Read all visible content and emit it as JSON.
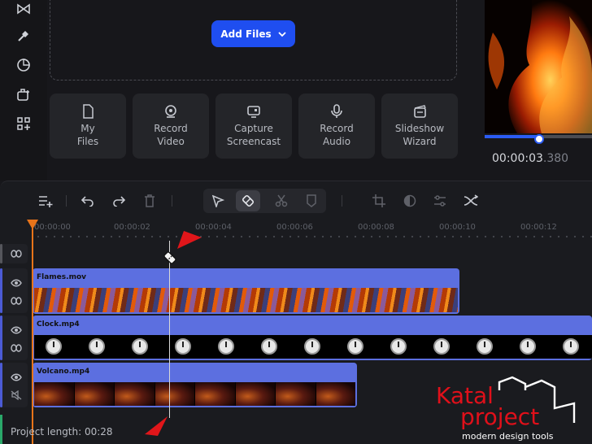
{
  "sidebar": {
    "icons": [
      "transitions-icon",
      "effects-icon",
      "filters-icon",
      "elements-icon",
      "more-icon"
    ]
  },
  "import_area": {
    "add_files_label": "Add Files"
  },
  "record_tiles": [
    {
      "label": "My\nFiles",
      "icon": "file-icon"
    },
    {
      "label": "Record\nVideo",
      "icon": "webcam-icon"
    },
    {
      "label": "Capture\nScreencast",
      "icon": "monitor-icon"
    },
    {
      "label": "Record\nAudio",
      "icon": "microphone-icon"
    },
    {
      "label": "Slideshow\nWizard",
      "icon": "slideshow-icon"
    }
  ],
  "preview": {
    "time_main": "00:00:03",
    "time_ms": ".380",
    "progress": 0.5
  },
  "toolbar": {
    "tools": [
      "add-track-icon",
      "undo-icon",
      "redo-icon",
      "delete-icon",
      "pointer-icon",
      "razor-icon",
      "scissors-icon",
      "marker-icon",
      "crop-icon",
      "color-icon",
      "adjust-icon",
      "transition-icon"
    ]
  },
  "ruler": {
    "ticks": [
      "00:00:00",
      "00:00:02",
      "00:00:04",
      "00:00:06",
      "00:00:08",
      "00:00:10",
      "00:00:12"
    ]
  },
  "tracks": [
    {
      "name": "Flames.mov"
    },
    {
      "name": "Clock.mp4"
    },
    {
      "name": "Volcano.mp4"
    }
  ],
  "status": {
    "project_length": "Project length: 00:28"
  },
  "watermark": {
    "line1": "Katal",
    "line2": "project",
    "line3": "modern design tools"
  },
  "colors": {
    "accent": "#1f4ef0",
    "clip": "#5c6fe0",
    "playhead": "#e8741a",
    "annotation_arrow": "#e0161a"
  }
}
